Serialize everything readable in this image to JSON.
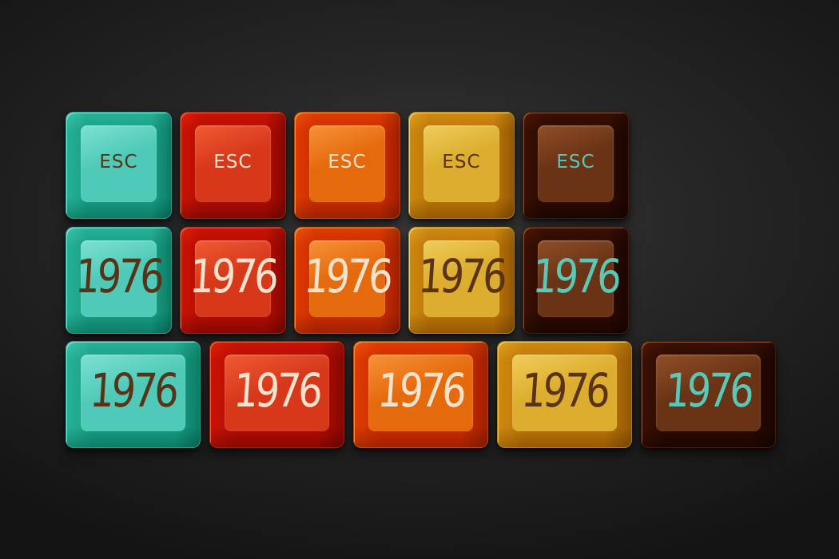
{
  "keycaps": {
    "row1": [
      {
        "legend": "ESC",
        "colorway": "teal",
        "cap": "#4fcab8",
        "light": "#7ee0d2",
        "dark": "#2a9c8c",
        "legend_color": "#5a3216"
      },
      {
        "legend": "ESC",
        "colorway": "red",
        "cap": "#d7381a",
        "light": "#f05a34",
        "dark": "#9e2410",
        "legend_color": "#f3e3cf"
      },
      {
        "legend": "ESC",
        "colorway": "orange",
        "cap": "#e56a0c",
        "light": "#f79238",
        "dark": "#b04e06",
        "legend_color": "#f3e3cf"
      },
      {
        "legend": "ESC",
        "colorway": "yellow",
        "cap": "#dcad2e",
        "light": "#f0cc5c",
        "dark": "#ab821c",
        "legend_color": "#5a3216"
      },
      {
        "legend": "ESC",
        "colorway": "brown",
        "cap": "#6a3316",
        "light": "#8f4f26",
        "dark": "#431d0a",
        "legend_color": "#57c9b8"
      }
    ],
    "row2": [
      {
        "legend": "1976",
        "colorway": "teal",
        "cap": "#4fcab8",
        "light": "#7ee0d2",
        "dark": "#2a9c8c",
        "legend_color": "#5a3216"
      },
      {
        "legend": "1976",
        "colorway": "red",
        "cap": "#d7381a",
        "light": "#f05a34",
        "dark": "#9e2410",
        "legend_color": "#f3e3cf"
      },
      {
        "legend": "1976",
        "colorway": "orange",
        "cap": "#e56a0c",
        "light": "#f79238",
        "dark": "#b04e06",
        "legend_color": "#f3e3cf"
      },
      {
        "legend": "1976",
        "colorway": "yellow",
        "cap": "#dcad2e",
        "light": "#f0cc5c",
        "dark": "#ab821c",
        "legend_color": "#5a3216"
      },
      {
        "legend": "1976",
        "colorway": "brown",
        "cap": "#6a3316",
        "light": "#8f4f26",
        "dark": "#431d0a",
        "legend_color": "#57c9b8"
      }
    ],
    "row3": [
      {
        "legend": "1976",
        "colorway": "teal",
        "cap": "#4fcab8",
        "light": "#7ee0d2",
        "dark": "#2a9c8c",
        "legend_color": "#5a3216"
      },
      {
        "legend": "1976",
        "colorway": "red",
        "cap": "#d7381a",
        "light": "#f05a34",
        "dark": "#9e2410",
        "legend_color": "#f3e3cf"
      },
      {
        "legend": "1976",
        "colorway": "orange",
        "cap": "#e56a0c",
        "light": "#f79238",
        "dark": "#b04e06",
        "legend_color": "#f3e3cf"
      },
      {
        "legend": "1976",
        "colorway": "yellow",
        "cap": "#dcad2e",
        "light": "#f0cc5c",
        "dark": "#ab821c",
        "legend_color": "#5a3216"
      },
      {
        "legend": "1976",
        "colorway": "brown",
        "cap": "#6a3316",
        "light": "#8f4f26",
        "dark": "#431d0a",
        "legend_color": "#57c9b8"
      }
    ]
  }
}
